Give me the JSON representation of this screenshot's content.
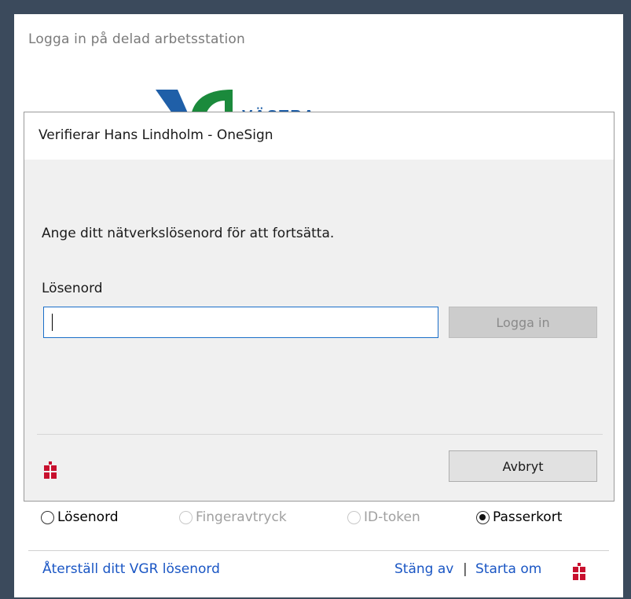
{
  "window": {
    "title": "Logga in på delad arbetsstation",
    "logo_text": "VÄSTRA"
  },
  "dialog": {
    "title": "Verifierar Hans Lindholm - OneSign",
    "prompt": "Ange ditt nätverkslösenord för att fortsätta.",
    "password_label": "Lösenord",
    "password_value": "",
    "login_label": "Logga in",
    "cancel_label": "Avbryt"
  },
  "auth_methods": [
    {
      "label": "Lösenord",
      "selected": false,
      "enabled": true
    },
    {
      "label": "Fingeravtryck",
      "selected": false,
      "enabled": false
    },
    {
      "label": "ID-token",
      "selected": false,
      "enabled": false
    },
    {
      "label": "Passerkort",
      "selected": true,
      "enabled": true
    }
  ],
  "footer": {
    "reset_link": "Återställ ditt VGR lösenord",
    "shutdown_link": "Stäng av",
    "divider": "|",
    "restart_link": "Starta om"
  },
  "colors": {
    "accent": "#1a6fc9",
    "link": "#1a56c4",
    "brand_red": "#c8102e",
    "logo_blue": "#1f5fa8",
    "logo_green": "#1b8a3c"
  },
  "icons": {
    "brand": "imprivata-logo-icon",
    "logo": "vgr-logo-icon"
  }
}
